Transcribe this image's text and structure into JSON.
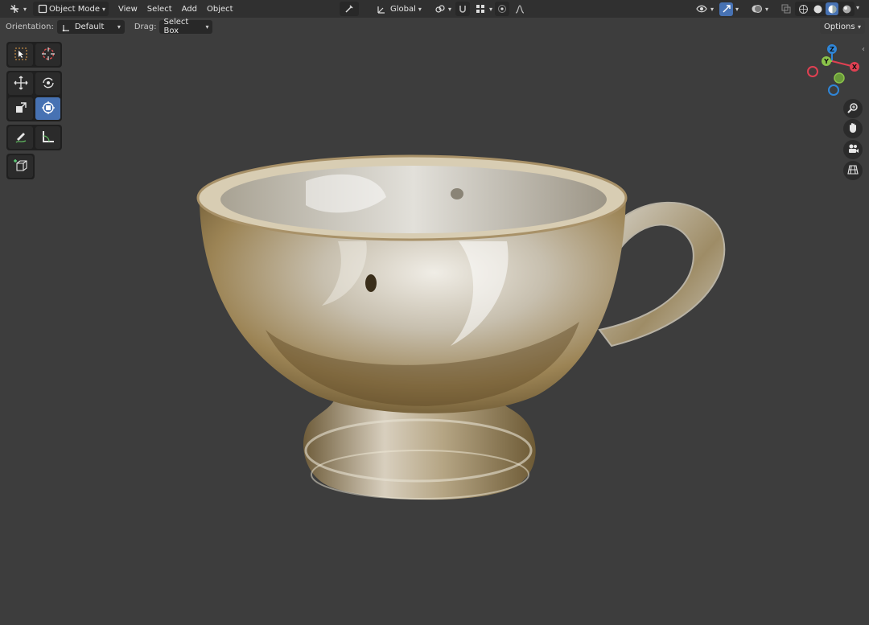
{
  "header": {
    "mode_label": "Object Mode",
    "menus": [
      "View",
      "Select",
      "Add",
      "Object"
    ],
    "orientation_global": "Global"
  },
  "tool_settings": {
    "orientation_label": "Orientation:",
    "orientation_value": "Default",
    "drag_label": "Drag:",
    "drag_value": "Select Box",
    "options_label": "Options"
  },
  "gizmo": {
    "z": "Z",
    "y": "Y",
    "x": "X"
  },
  "colors": {
    "header_bg": "#303030",
    "viewport_bg": "#3d3d3d",
    "accent": "#4772b3",
    "axis_x": "#e04052",
    "axis_y": "#8bc34a",
    "axis_z": "#2f86d8"
  },
  "icons": {
    "tools": [
      "select-box-icon",
      "cursor-icon",
      "move-icon",
      "rotate-icon",
      "scale-icon",
      "transform-icon",
      "annotate-icon",
      "measure-icon",
      "add-cube-icon"
    ],
    "nav": [
      "zoom-icon",
      "hand-icon",
      "camera-icon",
      "grid-icon"
    ]
  }
}
